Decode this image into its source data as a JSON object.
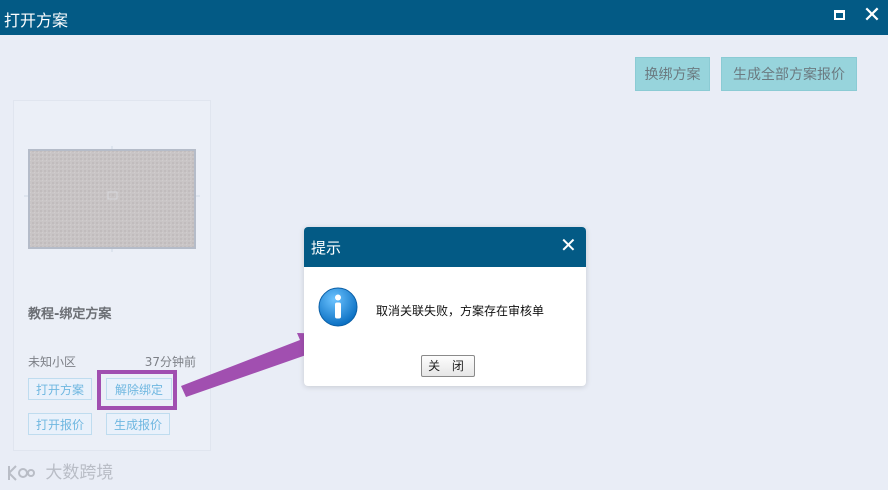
{
  "window": {
    "title": "打开方案",
    "maximize_icon": "maximize-icon",
    "close_icon": "close-icon",
    "header_color": "#035a85"
  },
  "toolbar": {
    "rebind_label": "换绑方案",
    "generate_all_label": "生成全部方案报价"
  },
  "card": {
    "name": "教程-绑定方案",
    "location": "未知小区",
    "time": "37分钟前",
    "buttons": {
      "open_plan": "打开方案",
      "unbind": "解除绑定",
      "open_quote": "打开报价",
      "generate_quote": "生成报价"
    }
  },
  "dialog": {
    "title": "提示",
    "message": "取消关联失败，方案存在审核单",
    "close_button": "关 闭",
    "icon": "info-icon"
  },
  "watermark": {
    "text": "大数跨境"
  },
  "annotation": {
    "color": "#a14fb0"
  }
}
